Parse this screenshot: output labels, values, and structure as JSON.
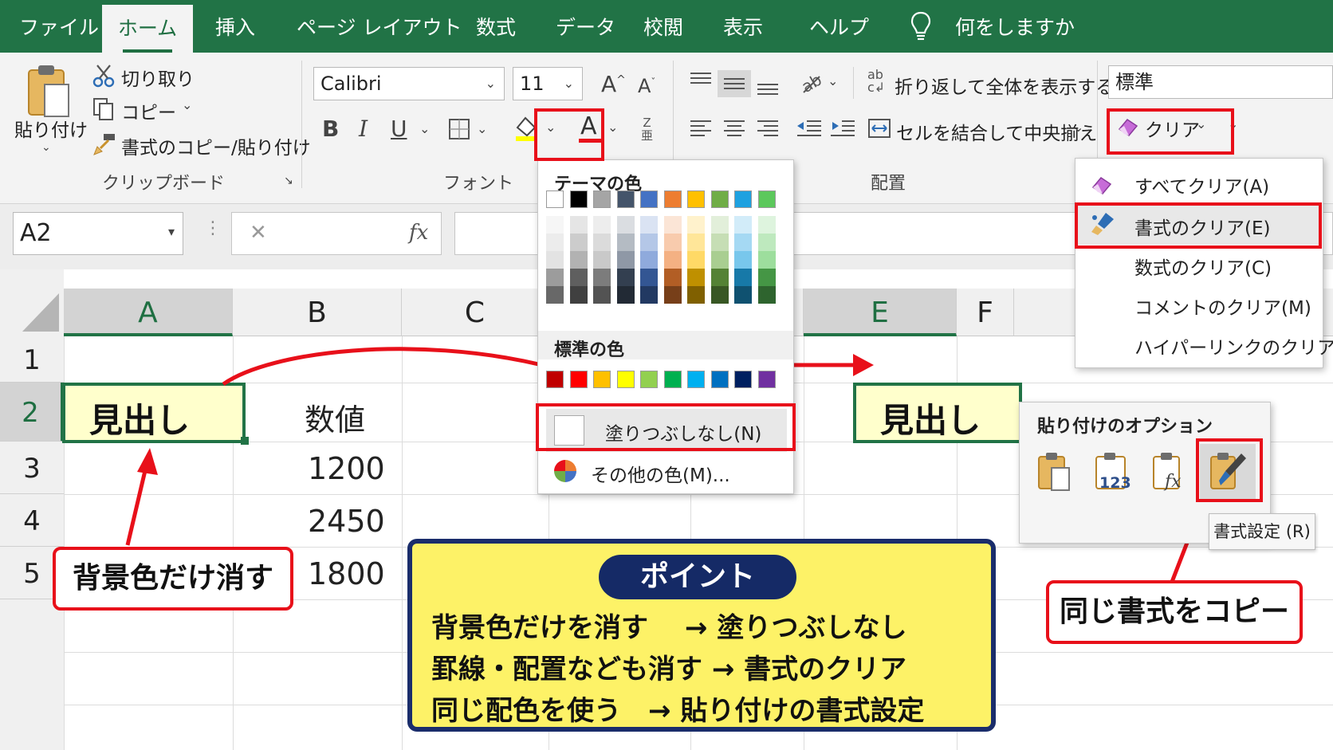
{
  "tabs": [
    "ファイル",
    "ホーム",
    "挿入",
    "ページ レイアウト",
    "数式",
    "データ",
    "校閲",
    "表示",
    "ヘルプ"
  ],
  "active_tab": "ホーム",
  "tell_me": "何をしますか",
  "clipboard": {
    "paste": "貼り付け",
    "cut": "切り取り",
    "copy": "コピー",
    "format_painter": "書式のコピー/貼り付け",
    "group": "クリップボード"
  },
  "font": {
    "name": "Calibri",
    "size": "11",
    "bold": "B",
    "italic": "I",
    "underline": "U",
    "font_color_glyph": "A",
    "group": "フォント"
  },
  "alignment": {
    "wrap": "折り返して全体を表示する",
    "merge": "セルを結合して中央揃え",
    "group": "配置"
  },
  "number_format": "標準",
  "clear_button": "クリア",
  "name_box": "A2",
  "formula_glyphs": {
    "cancel": "✕",
    "fx": "fx"
  },
  "columns": [
    "A",
    "B",
    "C",
    "E",
    "F"
  ],
  "rows": [
    "1",
    "2",
    "3",
    "4",
    "5"
  ],
  "cells": {
    "a2": "見出し",
    "b2": "数値",
    "b3": "1200",
    "b4": "2450",
    "b5": "1800",
    "e2": "見出し"
  },
  "fill_menu": {
    "theme_colors": "テーマの色",
    "standard_colors": "標準の色",
    "no_fill": "塗りつぶしなし(N)",
    "more_colors": "その他の色(M)...",
    "theme_top": [
      "#ffffff",
      "#000000",
      "#a5a5a5",
      "#44546a",
      "#4472c4",
      "#ed7d31",
      "#ffc000",
      "#70ad47",
      "#1ea1e0",
      "#5cc85c"
    ],
    "standard": [
      "#c00000",
      "#ff0000",
      "#ffc000",
      "#ffff00",
      "#92d050",
      "#00b050",
      "#00b0f0",
      "#0070c0",
      "#002060",
      "#7030a0"
    ]
  },
  "clear_menu": {
    "items": [
      "すべてクリア(A)",
      "書式のクリア(E)",
      "数式のクリア(C)",
      "コメントのクリア(M)",
      "ハイパーリンクのクリア(L)"
    ]
  },
  "paste_options": {
    "title": "貼り付けのオプション",
    "tooltip": "書式設定 (R)",
    "values_label": "123"
  },
  "callouts": {
    "bg_only": "背景色だけ消す",
    "copy_format": "同じ書式をコピー"
  },
  "point": {
    "title": "ポイント",
    "lines": [
      "背景色だけを消す　 → 塗りつぶしなし",
      "罫線・配置なども消す → 書式のクリア",
      "同じ配色を使う　→ 貼り付けの書式設定"
    ]
  },
  "colors": {
    "excel_green": "#217346",
    "highlight_red": "#e8101a",
    "cell_fill": "#ffffcc",
    "point_yellow": "#fdf267",
    "point_navy": "#152a66"
  }
}
